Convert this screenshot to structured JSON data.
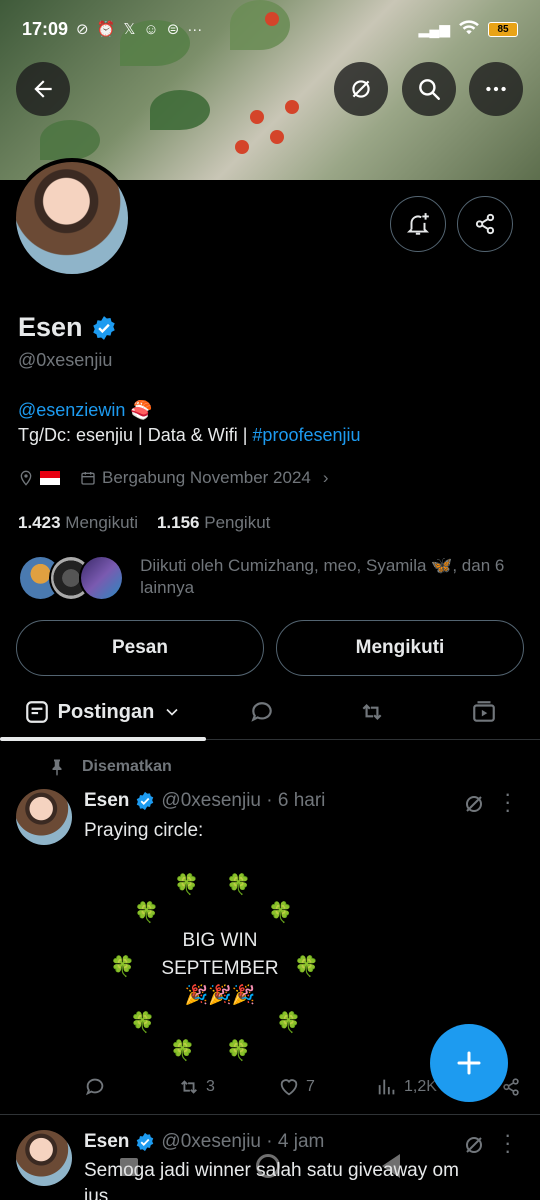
{
  "status_bar": {
    "time": "17:09",
    "icons": [
      "muted-alarm-icon",
      "alarm-icon",
      "x-icon",
      "robot-icon",
      "game-icon",
      "more-dots"
    ],
    "battery": "85"
  },
  "profile": {
    "name": "Esen",
    "handle": "@0xesenjiu",
    "bio_link": "@esenziewin 🍣",
    "bio_line2_prefix": "Tg/Dc: esenjiu | Data & Wifi | ",
    "bio_line2_link": "#proofesenjiu",
    "joined": "Bergabung November 2024",
    "following_count": "1.423",
    "following_label": "Mengikuti",
    "followers_count": "1.156",
    "followers_label": "Pengikut",
    "followed_by": "Diikuti oleh Cumizhang, meo, Syamila 🦋, dan 6 lainnya"
  },
  "buttons": {
    "message": "Pesan",
    "following": "Mengikuti"
  },
  "tabs": {
    "posts": "Postingan"
  },
  "pinned_label": "Disematkan",
  "tweets": [
    {
      "name": "Esen",
      "handle_time": "@0xesenjiu · 6 hari",
      "text": "Praying circle:",
      "center_text_1": "BIG WIN",
      "center_text_2": "SEPTEMBER",
      "center_text_3": "🎉🎉🎉",
      "clover": "🍀",
      "replies": "",
      "retweets": "3",
      "likes": "7",
      "views": "1,2K"
    },
    {
      "name": "Esen",
      "handle_time": "@0xesenjiu · 4 jam",
      "text": "Semoga jadi winner salah satu giveaway om",
      "text2": "jus"
    }
  ],
  "colors": {
    "accent": "#1d9bf0",
    "background": "#000000",
    "text_primary": "#e7e9ea",
    "text_secondary": "#71767b",
    "border": "#536471"
  }
}
